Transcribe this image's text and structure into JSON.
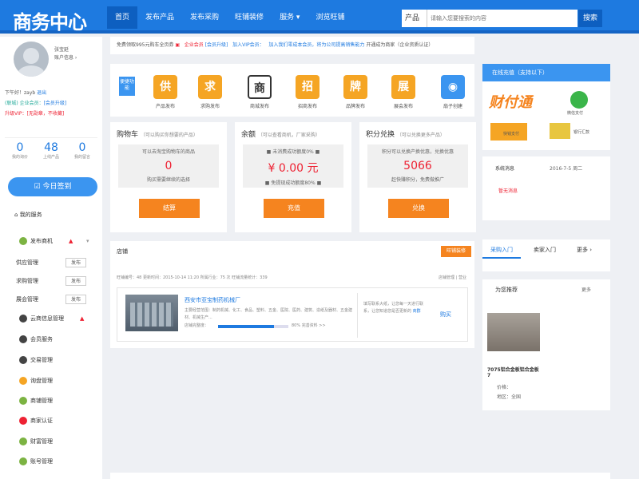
{
  "header": {
    "logo": "商务中心",
    "nav": [
      "首页",
      "发布产品",
      "发布采购",
      "旺铺装修",
      "服务 ▾",
      "浏览旺铺"
    ],
    "search_category": "产品",
    "search_placeholder": "请输入您要搜索的内容",
    "search_button": "搜索"
  },
  "user": {
    "name_line1": "张宝延",
    "name_line2": "账户信息 ›",
    "greeting": "下午好！zayb",
    "logout": "退出",
    "level_line": "(联城) 企业会员：",
    "level_upgrade": "[会员升级]",
    "vip_line": "升级VIP：",
    "vip_status": "[无勋章，不收藏]",
    "stats": [
      {
        "value": "0",
        "label": "我的询价"
      },
      {
        "value": "48",
        "label": "上线产品"
      },
      {
        "value": "0",
        "label": "我的留言"
      }
    ],
    "sign_button": "☑ 今日签到"
  },
  "sidebar": {
    "service_label": "我的服务",
    "publish_label": "发布商机",
    "items": [
      {
        "label": "供应管理",
        "tag": "发布"
      },
      {
        "label": "求购管理",
        "tag": "发布"
      },
      {
        "label": "展会管理",
        "tag": "发布"
      }
    ],
    "menu": [
      "云商信息管理",
      "会员服务",
      "交易管理",
      "询盘管理",
      "商铺管理",
      "商家认证",
      "财富管理",
      "账号管理"
    ]
  },
  "notice": {
    "text": "免费领取995元购车全页券",
    "member": "企业会员",
    "upgrade": "[会员升级]",
    "vip": "加入VIP会员：",
    "link": "加入我们零成本会员，将为公司提高销售能力",
    "extra": "开通成为商家（企业资质认证）"
  },
  "quick": {
    "label": "便捷功能",
    "items": [
      {
        "icon": "供",
        "label": "产品发布"
      },
      {
        "icon": "求",
        "label": "求购发布"
      },
      {
        "icon": "商",
        "label": "商城发布"
      },
      {
        "icon": "招",
        "label": "招商发布"
      },
      {
        "icon": "牌",
        "label": "品牌发布"
      },
      {
        "icon": "展",
        "label": "展会发布"
      },
      {
        "icon": "◉",
        "label": "扇子创建"
      }
    ]
  },
  "cards": [
    {
      "title": "购物车",
      "sub": "（可以购买你想要的产品）",
      "line1": "可以去淘宝购物车的商品",
      "value": "0",
      "line2": "购买需要继续的选择",
      "button": "结算"
    },
    {
      "title": "余额",
      "sub": "（可以查看商机，厂家采购）",
      "line1": "■ 未消费成功额度0% ■",
      "value": "¥ 0.00 元",
      "line2": "■ 免提现成功额度80% ■",
      "button": "充值"
    },
    {
      "title": "积分兑换",
      "sub": "（可以兑换更多产品）",
      "line1": "积分可以兑换产换优惠，兑换优惠",
      "value": "5066",
      "line2": "赶快赚积分，免费做推广",
      "button": "兑换"
    }
  ],
  "shop": {
    "title": "店铺",
    "create": "旺铺装修",
    "info": "旺铺编号：48 更新时间：2015-10-14 11:20 所属行业：75 次 旺铺流量统计：339",
    "manage": "店铺管理 | 营业",
    "name": "西安市亚宝制药机械厂",
    "desc": "主要经营范围：制药机械、化工、食品、塑料、五金、医院、医药、建筑、造纸及器材、五金建材、机械生产...",
    "progress_label": "店铺完整度：",
    "progress": 0.8,
    "progress_text": "80%",
    "progress_more": "完善资料 >>",
    "tip": "填写联系大纸，让您每一天进行联系，让您知道您是否更新的",
    "tip_link": "商群",
    "buy": "购买"
  },
  "pay": {
    "title": "在线充值（支持以下）",
    "logo1": "财付通",
    "tags": [
      "微信支付",
      "银行汇款",
      "快钱支付",
      "银行汇款"
    ]
  },
  "system": {
    "label": "系统消息",
    "date": "2016-7-5 周二",
    "link": "暂无消息"
  },
  "tabs": [
    "采购入门",
    "卖家入门",
    "更多 ›"
  ],
  "recommend": {
    "title": "为您推荐",
    "more": "更多",
    "item_name": "7075铝合金板铝合金板 7",
    "item_price": "价格：",
    "item_area": "地区：全国"
  }
}
